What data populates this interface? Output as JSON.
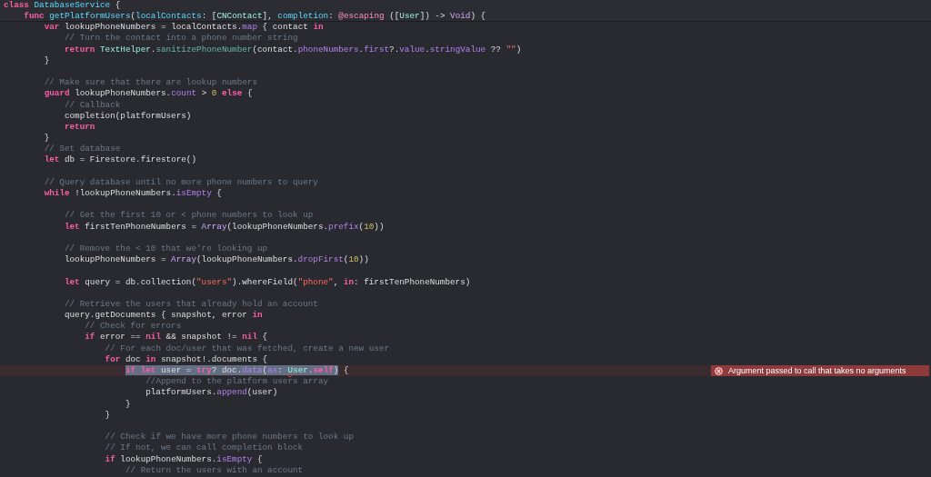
{
  "sticky_header": [
    {
      "kind": "code",
      "segments": [
        {
          "kind": "keyword",
          "text": "class"
        },
        {
          "kind": "decl",
          "text": " DatabaseService"
        },
        {
          "kind": "plain",
          "text": " {"
        }
      ]
    },
    {
      "kind": "code",
      "segments": [
        {
          "kind": "keyword",
          "text": "    func"
        },
        {
          "kind": "decl",
          "text": " getPlatformUsers"
        },
        {
          "kind": "plain",
          "text": "("
        },
        {
          "kind": "decl",
          "text": "localContacts"
        },
        {
          "kind": "plain",
          "text": ": ["
        },
        {
          "kind": "type",
          "text": "CNContact"
        },
        {
          "kind": "plain",
          "text": "], "
        },
        {
          "kind": "decl",
          "text": "completion"
        },
        {
          "kind": "plain",
          "text": ": "
        },
        {
          "kind": "attr",
          "text": "@escaping"
        },
        {
          "kind": "plain",
          "text": " (["
        },
        {
          "kind": "type",
          "text": "User"
        },
        {
          "kind": "plain",
          "text": "]) -> "
        },
        {
          "kind": "systype",
          "text": "Void"
        },
        {
          "kind": "plain",
          "text": ") {"
        }
      ]
    }
  ],
  "lines": [
    {
      "kind": "code",
      "segments": [
        {
          "kind": "keyword",
          "text": "        var"
        },
        {
          "kind": "plain",
          "text": " lookupPhoneNumbers = localContacts."
        },
        {
          "kind": "member",
          "text": "map"
        },
        {
          "kind": "plain",
          "text": " { contact "
        },
        {
          "kind": "keyword",
          "text": "in"
        }
      ]
    },
    {
      "kind": "code",
      "segments": [
        {
          "kind": "comment",
          "text": "            // Turn the contact into a phone number string"
        }
      ]
    },
    {
      "kind": "code",
      "segments": [
        {
          "kind": "keyword",
          "text": "            return"
        },
        {
          "kind": "type",
          "text": " TextHelper"
        },
        {
          "kind": "plain",
          "text": "."
        },
        {
          "kind": "method",
          "text": "sanitizePhoneNumber"
        },
        {
          "kind": "plain",
          "text": "(contact."
        },
        {
          "kind": "member",
          "text": "phoneNumbers"
        },
        {
          "kind": "plain",
          "text": "."
        },
        {
          "kind": "member",
          "text": "first"
        },
        {
          "kind": "plain",
          "text": "?."
        },
        {
          "kind": "member",
          "text": "value"
        },
        {
          "kind": "plain",
          "text": "."
        },
        {
          "kind": "member",
          "text": "stringValue"
        },
        {
          "kind": "plain",
          "text": " ?? "
        },
        {
          "kind": "string",
          "text": "\"\""
        },
        {
          "kind": "plain",
          "text": ")"
        }
      ]
    },
    {
      "kind": "code",
      "segments": [
        {
          "kind": "plain",
          "text": "        }"
        }
      ]
    },
    {
      "kind": "blank"
    },
    {
      "kind": "code",
      "segments": [
        {
          "kind": "comment",
          "text": "        // Make sure that there are lookup numbers"
        }
      ]
    },
    {
      "kind": "code",
      "segments": [
        {
          "kind": "keyword",
          "text": "        guard"
        },
        {
          "kind": "plain",
          "text": " lookupPhoneNumbers."
        },
        {
          "kind": "member",
          "text": "count"
        },
        {
          "kind": "plain",
          "text": " > "
        },
        {
          "kind": "number",
          "text": "0"
        },
        {
          "kind": "keyword",
          "text": " else"
        },
        {
          "kind": "plain",
          "text": " {"
        }
      ]
    },
    {
      "kind": "code",
      "segments": [
        {
          "kind": "comment",
          "text": "            // Callback"
        }
      ]
    },
    {
      "kind": "code",
      "segments": [
        {
          "kind": "plain",
          "text": "            completion(platformUsers)"
        }
      ]
    },
    {
      "kind": "code",
      "segments": [
        {
          "kind": "keyword",
          "text": "            return"
        }
      ]
    },
    {
      "kind": "code",
      "segments": [
        {
          "kind": "plain",
          "text": "        }"
        }
      ]
    },
    {
      "kind": "code",
      "segments": [
        {
          "kind": "comment",
          "text": "        // Set database"
        }
      ]
    },
    {
      "kind": "code",
      "segments": [
        {
          "kind": "keyword",
          "text": "        let"
        },
        {
          "kind": "plain",
          "text": " db = Firestore.firestore()"
        }
      ]
    },
    {
      "kind": "blank"
    },
    {
      "kind": "code",
      "segments": [
        {
          "kind": "comment",
          "text": "        // Query database until no more phone numbers to query"
        }
      ]
    },
    {
      "kind": "code",
      "segments": [
        {
          "kind": "keyword",
          "text": "        while"
        },
        {
          "kind": "plain",
          "text": " !lookupPhoneNumbers."
        },
        {
          "kind": "member",
          "text": "isEmpty"
        },
        {
          "kind": "plain",
          "text": " {"
        }
      ]
    },
    {
      "kind": "blank"
    },
    {
      "kind": "code",
      "segments": [
        {
          "kind": "comment",
          "text": "            // Get the first 10 or < phone numbers to look up"
        }
      ]
    },
    {
      "kind": "code",
      "segments": [
        {
          "kind": "keyword",
          "text": "            let"
        },
        {
          "kind": "plain",
          "text": " firstTenPhoneNumbers = "
        },
        {
          "kind": "systype",
          "text": "Array"
        },
        {
          "kind": "plain",
          "text": "(lookupPhoneNumbers."
        },
        {
          "kind": "member",
          "text": "prefix"
        },
        {
          "kind": "plain",
          "text": "("
        },
        {
          "kind": "number",
          "text": "10"
        },
        {
          "kind": "plain",
          "text": "))"
        }
      ]
    },
    {
      "kind": "blank"
    },
    {
      "kind": "code",
      "segments": [
        {
          "kind": "comment",
          "text": "            // Remove the < 10 that we're looking up"
        }
      ]
    },
    {
      "kind": "code",
      "segments": [
        {
          "kind": "plain",
          "text": "            lookupPhoneNumbers = "
        },
        {
          "kind": "systype",
          "text": "Array"
        },
        {
          "kind": "plain",
          "text": "(lookupPhoneNumbers."
        },
        {
          "kind": "member",
          "text": "dropFirst"
        },
        {
          "kind": "plain",
          "text": "("
        },
        {
          "kind": "number",
          "text": "10"
        },
        {
          "kind": "plain",
          "text": "))"
        }
      ]
    },
    {
      "kind": "blank"
    },
    {
      "kind": "code",
      "segments": [
        {
          "kind": "keyword",
          "text": "            let"
        },
        {
          "kind": "plain",
          "text": " query = db.collection("
        },
        {
          "kind": "string",
          "text": "\"users\""
        },
        {
          "kind": "plain",
          "text": ").whereField("
        },
        {
          "kind": "string",
          "text": "\"phone\""
        },
        {
          "kind": "plain",
          "text": ", "
        },
        {
          "kind": "keyword",
          "text": "in"
        },
        {
          "kind": "plain",
          "text": ": firstTenPhoneNumbers)"
        }
      ]
    },
    {
      "kind": "blank"
    },
    {
      "kind": "code",
      "segments": [
        {
          "kind": "comment",
          "text": "            // Retrieve the users that already hold an account"
        }
      ]
    },
    {
      "kind": "code",
      "segments": [
        {
          "kind": "plain",
          "text": "            query.getDocuments { snapshot, error "
        },
        {
          "kind": "keyword",
          "text": "in"
        }
      ]
    },
    {
      "kind": "code",
      "segments": [
        {
          "kind": "comment",
          "text": "                // Check for errors"
        }
      ]
    },
    {
      "kind": "code",
      "segments": [
        {
          "kind": "keyword",
          "text": "                if"
        },
        {
          "kind": "plain",
          "text": " error == "
        },
        {
          "kind": "keyword",
          "text": "nil"
        },
        {
          "kind": "plain",
          "text": " && snapshot != "
        },
        {
          "kind": "keyword",
          "text": "nil"
        },
        {
          "kind": "plain",
          "text": " {"
        }
      ]
    },
    {
      "kind": "code",
      "segments": [
        {
          "kind": "comment",
          "text": "                    // For each doc/user that was fetched, create a new user"
        }
      ]
    },
    {
      "kind": "code",
      "segments": [
        {
          "kind": "keyword",
          "text": "                    for"
        },
        {
          "kind": "plain",
          "text": " doc "
        },
        {
          "kind": "keyword",
          "text": "in"
        },
        {
          "kind": "plain",
          "text": " snapshot!.documents {"
        }
      ]
    },
    {
      "kind": "code",
      "error": {
        "message": "Argument passed to call that takes no arguments"
      },
      "segments": [
        {
          "kind": "selection",
          "segments": [
            {
              "kind": "keyword",
              "text": "                        if let"
            },
            {
              "kind": "plain",
              "text": " user = "
            },
            {
              "kind": "keyword",
              "text": "try"
            },
            {
              "kind": "plain",
              "text": "? doc."
            },
            {
              "kind": "member",
              "text": "data"
            },
            {
              "kind": "plain",
              "text": "("
            },
            {
              "kind": "member",
              "text": "as"
            },
            {
              "kind": "plain",
              "text": ": "
            },
            {
              "kind": "flagged",
              "text": "U"
            },
            {
              "kind": "type",
              "text": "ser"
            },
            {
              "kind": "plain",
              "text": "."
            },
            {
              "kind": "keyword",
              "text": "self"
            },
            {
              "kind": "plain",
              "text": ")"
            }
          ]
        },
        {
          "kind": "plain",
          "text": " {"
        }
      ]
    },
    {
      "kind": "code",
      "segments": [
        {
          "kind": "comment",
          "text": "                            //Append to the platform users array"
        }
      ]
    },
    {
      "kind": "code",
      "segments": [
        {
          "kind": "plain",
          "text": "                            platformUsers."
        },
        {
          "kind": "member",
          "text": "append"
        },
        {
          "kind": "plain",
          "text": "(user)"
        }
      ]
    },
    {
      "kind": "code",
      "segments": [
        {
          "kind": "plain",
          "text": "                        }"
        }
      ]
    },
    {
      "kind": "code",
      "segments": [
        {
          "kind": "plain",
          "text": "                    }"
        }
      ]
    },
    {
      "kind": "blank"
    },
    {
      "kind": "code",
      "segments": [
        {
          "kind": "comment",
          "text": "                    // Check if we have more phone numbers to look up"
        }
      ]
    },
    {
      "kind": "code",
      "segments": [
        {
          "kind": "comment",
          "text": "                    // If not, we can call completion block"
        }
      ]
    },
    {
      "kind": "code",
      "segments": [
        {
          "kind": "keyword",
          "text": "                    if"
        },
        {
          "kind": "plain",
          "text": " lookupPhoneNumbers."
        },
        {
          "kind": "member",
          "text": "isEmpty"
        },
        {
          "kind": "plain",
          "text": " {"
        }
      ]
    },
    {
      "kind": "code",
      "segments": [
        {
          "kind": "comment",
          "text": "                        // Return the users with an account"
        }
      ]
    }
  ]
}
